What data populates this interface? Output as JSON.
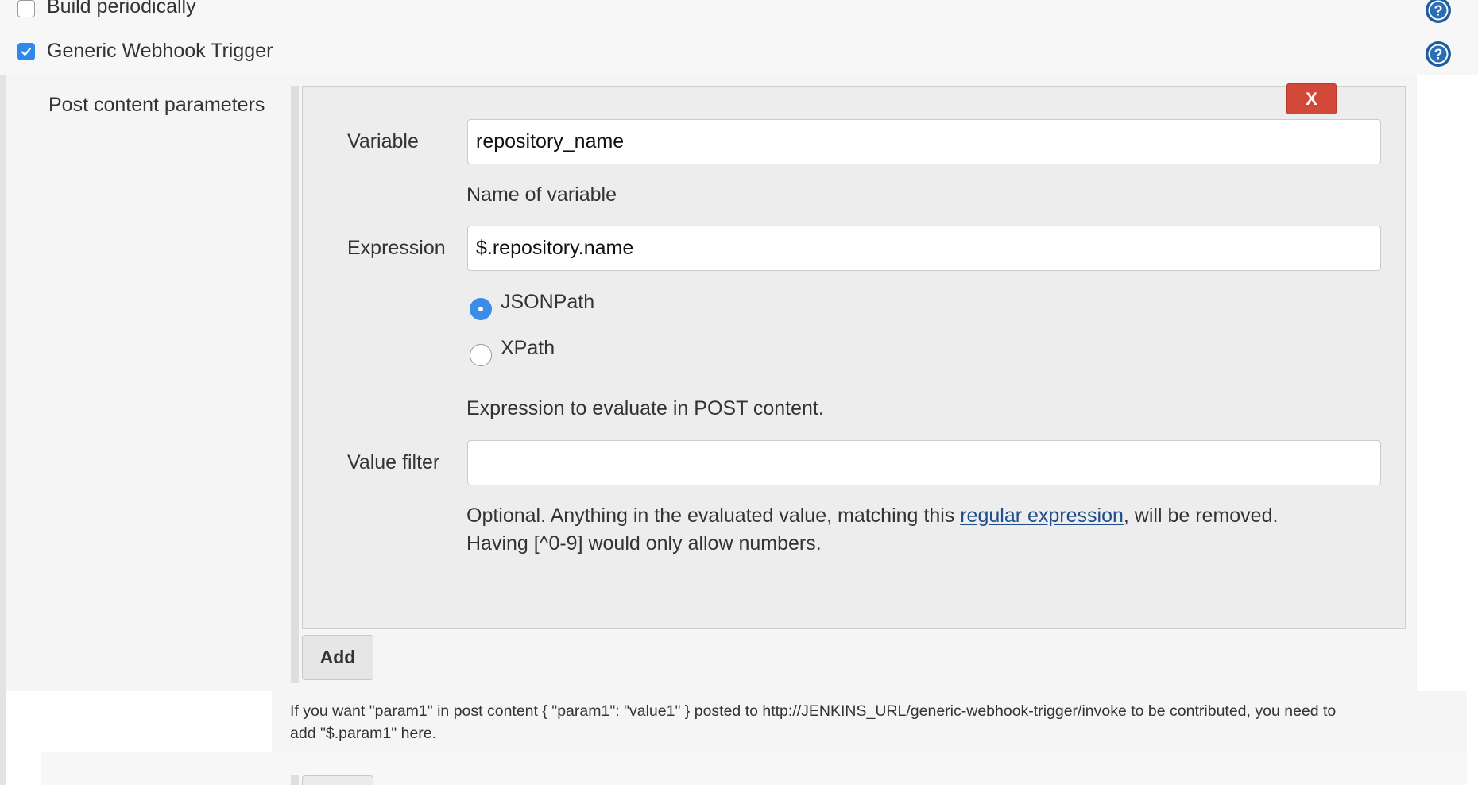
{
  "triggers": {
    "build_periodically": {
      "label": "Build periodically",
      "checked": false
    },
    "generic_webhook": {
      "label": "Generic Webhook Trigger",
      "checked": true
    }
  },
  "post_content": {
    "section_label": "Post content parameters",
    "delete_label": "X",
    "variable": {
      "label": "Variable",
      "value": "repository_name",
      "help": "Name of variable"
    },
    "expression": {
      "label": "Expression",
      "value": "$.repository.name",
      "options": [
        {
          "label": "JSONPath",
          "selected": true
        },
        {
          "label": "XPath",
          "selected": false
        }
      ],
      "help": "Expression to evaluate in POST content."
    },
    "value_filter": {
      "label": "Value filter",
      "value": "",
      "help_before_link": "Optional. Anything in the evaluated value, matching this ",
      "help_link": "regular expression",
      "help_after_link": ", will be removed.",
      "help_line2": "Having [^0-9] would only allow numbers."
    },
    "add_label": "Add",
    "footer_help_line1": "If you want \"param1\" in post content { \"param1\": \"value1\" } posted to http://JENKINS_URL/generic-webhook-trigger/invoke to be contributed, you need to",
    "footer_help_line2": "add \"$.param1\" here."
  },
  "colors": {
    "accent": "#2e89ea",
    "delete": "#d24939",
    "link": "#1f4e8c",
    "help_icon": "#1f5e9e"
  }
}
